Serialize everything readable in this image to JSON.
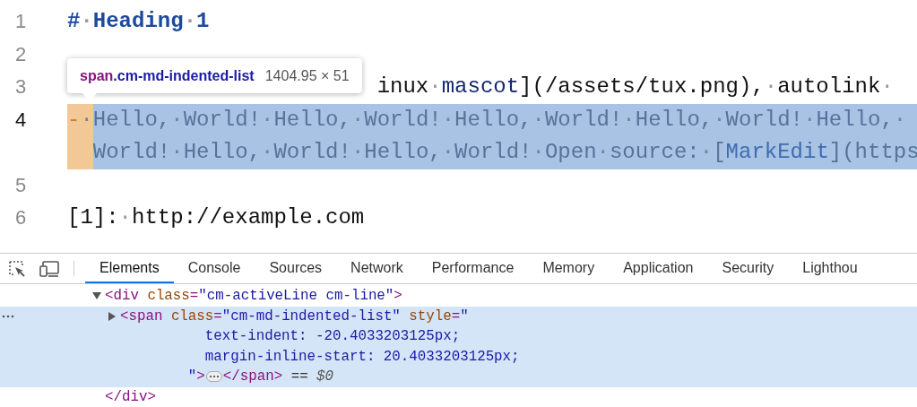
{
  "editor": {
    "lines": [
      {
        "number": "1",
        "active": false,
        "rows": [
          [
            {
              "text": "#·Heading·1",
              "kind": "heading"
            }
          ]
        ]
      },
      {
        "number": "2",
        "active": false
      },
      {
        "number": "3",
        "active": false,
        "hidden_start": true,
        "rows": [
          [
            {
              "text": "inux·",
              "kind": "plain"
            },
            {
              "text": "mascot",
              "kind": "link-text"
            },
            {
              "text": "](/assets/tux.png),·autolink·",
              "kind": "plain"
            }
          ]
        ]
      },
      {
        "number": "4",
        "active": true,
        "highlighted": true,
        "marker": "-·",
        "rows": [
          [
            {
              "text": "Hello,·World!·Hello,·World!·Hello,·World!·Hello,·World!·Hello,·",
              "kind": "plain"
            }
          ],
          [
            {
              "text": "World!·Hello,·World!·Hello,·World!·Open·source:·[",
              "kind": "plain"
            },
            {
              "text": "MarkEdit",
              "kind": "link-text"
            },
            {
              "text": "](https",
              "kind": "plain"
            }
          ]
        ]
      },
      {
        "number": "5",
        "active": false
      },
      {
        "number": "6",
        "active": false,
        "rows": [
          [
            {
              "text": "[1]:·http://example.com",
              "kind": "plain"
            }
          ]
        ]
      }
    ]
  },
  "tooltip": {
    "selector_tag": "span",
    "selector_class": ".cm-md-indented-list",
    "size": "1404.95 × 51"
  },
  "devtools": {
    "tabs": [
      {
        "label": "Elements",
        "selected": true
      },
      {
        "label": "Console",
        "selected": false
      },
      {
        "label": "Sources",
        "selected": false
      },
      {
        "label": "Network",
        "selected": false
      },
      {
        "label": "Performance",
        "selected": false
      },
      {
        "label": "Memory",
        "selected": false
      },
      {
        "label": "Application",
        "selected": false
      },
      {
        "label": "Security",
        "selected": false
      },
      {
        "label": "Lighthou",
        "selected": false
      }
    ],
    "tree": [
      {
        "expanded": true,
        "selected": false,
        "lines": [
          [
            {
              "text": "<div",
              "kind": "tag"
            },
            {
              "text": " class",
              "kind": "attr-name"
            },
            {
              "text": "=",
              "kind": "tag"
            },
            {
              "text": "\"cm-activeLine cm-line\"",
              "kind": "attr-value"
            },
            {
              "text": ">",
              "kind": "tag"
            }
          ]
        ],
        "children": [
          {
            "expanded": false,
            "selected": true,
            "lines": [
              [
                {
                  "text": "<span",
                  "kind": "tag"
                },
                {
                  "text": " class",
                  "kind": "attr-name"
                },
                {
                  "text": "=",
                  "kind": "tag"
                },
                {
                  "text": "\"cm-md-indented-list\"",
                  "kind": "attr-value"
                },
                {
                  "text": " style",
                  "kind": "attr-name"
                },
                {
                  "text": "=",
                  "kind": "tag"
                },
                {
                  "text": "\"",
                  "kind": "attr-value"
                }
              ],
              [
                {
                  "text": "          text-indent: -20.4033203125px;",
                  "kind": "attr-value"
                }
              ],
              [
                {
                  "text": "          margin-inline-start: 20.4033203125px;",
                  "kind": "attr-value"
                }
              ],
              [
                {
                  "text": "        \"",
                  "kind": "attr-value"
                },
                {
                  "text": ">",
                  "kind": "tag"
                },
                {
                  "kind": "ellipsis"
                },
                {
                  "text": "</span>",
                  "kind": "tag"
                },
                {
                  "text": " == ",
                  "kind": "plain"
                },
                {
                  "text": "$0",
                  "kind": "hint"
                }
              ]
            ]
          }
        ],
        "closing": [
          {
            "text": "</div>",
            "kind": "tag"
          }
        ]
      }
    ]
  }
}
